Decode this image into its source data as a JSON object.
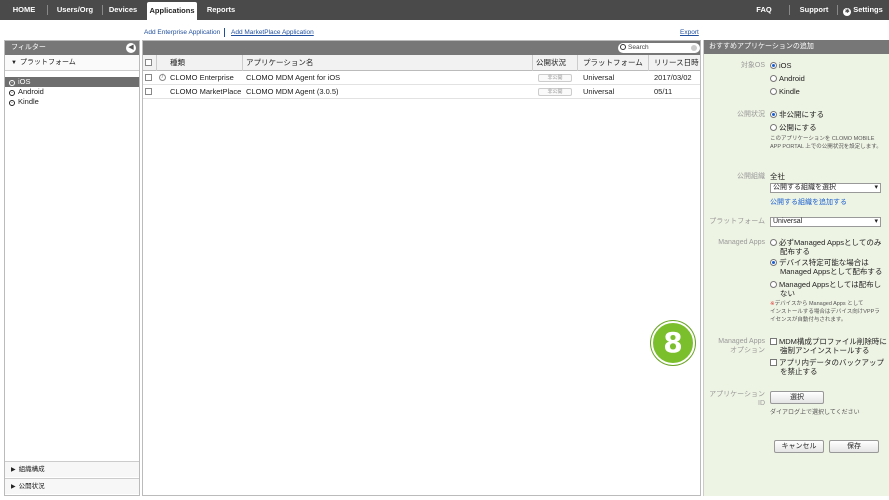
{
  "nav": {
    "tabs": [
      "HOME",
      "Users/Org",
      "Devices",
      "Applications",
      "Reports"
    ],
    "active_tab": "Applications",
    "right_items": [
      "FAQ",
      "Support",
      "Settings"
    ]
  },
  "links": {
    "add_enterprise": "Add Enterprise Application",
    "add_marketplace": "Add MarketPlace Application",
    "export": "Export"
  },
  "filter": {
    "title": "フィルター",
    "platform_section": "プラットフォーム",
    "platforms": [
      "iOS",
      "Android",
      "Kindle"
    ],
    "selected_platform": "iOS",
    "org_section": "組織構成",
    "publish_section": "公開状況"
  },
  "table": {
    "search_placeholder": "Search",
    "columns": [
      "種類",
      "アプリケーション名",
      "公開状況",
      "プラットフォーム",
      "リリース日時"
    ],
    "rows": [
      {
        "type": "CLOMO Enterprise",
        "name": "CLOMO MDM Agent for iOS",
        "status": "非公開",
        "platform": "Universal",
        "date": "2017/03/02"
      },
      {
        "type": "CLOMO MarketPlace",
        "name": "CLOMO MDM Agent (3.0.5)",
        "status": "非公開",
        "platform": "Universal",
        "date": "05/11"
      }
    ]
  },
  "form": {
    "title": "おすすめアプリケーションの追加",
    "target_os_label": "対象OS",
    "target_os": [
      "iOS",
      "Android",
      "Kindle"
    ],
    "publish_label": "公開状況",
    "publish_options": [
      "非公開にする",
      "公開にする"
    ],
    "publish_note": "このアプリケーションを CLOMO MOBILE APP PORTAL 上での公開状況を設定します。",
    "org_label": "公開組織",
    "org_value": "全社",
    "org_select": "公開する組織を選択",
    "org_add_link": "公開する組織を追加する",
    "platform_label": "プラットフォーム",
    "platform_value": "Universal",
    "managed_label": "Managed Apps",
    "managed_options": [
      [
        "必ずManaged Appsとしてのみ",
        "配布する"
      ],
      [
        "デバイス特定可能な場合は",
        "Managed Appsとして配布する"
      ],
      [
        "Managed Appsとしては配布し",
        "ない"
      ]
    ],
    "managed_note_mark": "※",
    "managed_note": [
      "デバイスから Managed Apps として",
      "インストールする場合はデバイス向けVPPラ",
      "イセンスが自動付与されます。"
    ],
    "managed_opt_label": [
      "Managed Apps",
      "オプション"
    ],
    "managed_opt_checks": [
      [
        "MDM構成プロファイル削除時に",
        "強制アンインストールする"
      ],
      [
        "アプリ内データのバックアップ",
        "を禁止する"
      ]
    ],
    "app_id_label": [
      "アプリケーション",
      "ID"
    ],
    "select_button": "選択",
    "select_note": "ダイアログ上で選択してください",
    "cancel_button": "キャンセル",
    "save_button": "保存"
  },
  "annotation": {
    "step": "8"
  },
  "colors": {
    "nav_bg": "#4a4a4a",
    "panel_bg": "#eef4e4",
    "accent": "#7cbf2d",
    "link": "#1f4e9c"
  }
}
